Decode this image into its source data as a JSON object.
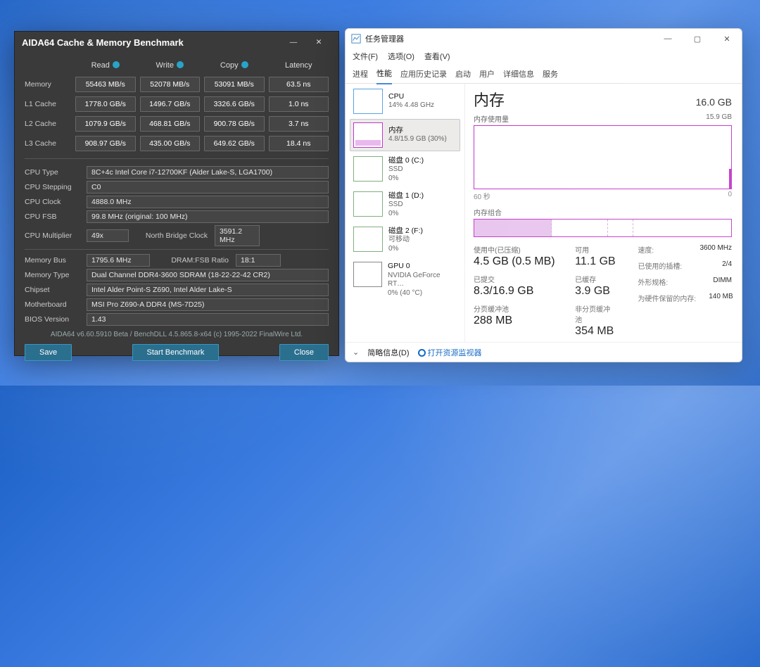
{
  "aida": {
    "title": "AIDA64 Cache & Memory Benchmark",
    "headers": {
      "read": "Read",
      "write": "Write",
      "copy": "Copy",
      "latency": "Latency"
    },
    "rows": [
      {
        "label": "Memory",
        "read": "55463 MB/s",
        "write": "52078 MB/s",
        "copy": "53091 MB/s",
        "lat": "63.5 ns"
      },
      {
        "label": "L1 Cache",
        "read": "1778.0 GB/s",
        "write": "1496.7 GB/s",
        "copy": "3326.6 GB/s",
        "lat": "1.0 ns"
      },
      {
        "label": "L2 Cache",
        "read": "1079.9 GB/s",
        "write": "468.81 GB/s",
        "copy": "900.78 GB/s",
        "lat": "3.7 ns"
      },
      {
        "label": "L3 Cache",
        "read": "908.97 GB/s",
        "write": "435.00 GB/s",
        "copy": "649.62 GB/s",
        "lat": "18.4 ns"
      }
    ],
    "info": {
      "cpu_type_label": "CPU Type",
      "cpu_type": "8C+4c Intel Core i7-12700KF  (Alder Lake-S, LGA1700)",
      "cpu_step_label": "CPU Stepping",
      "cpu_step": "C0",
      "cpu_clock_label": "CPU Clock",
      "cpu_clock": "4888.0 MHz",
      "cpu_fsb_label": "CPU FSB",
      "cpu_fsb": "99.8 MHz  (original: 100 MHz)",
      "cpu_mult_label": "CPU Multiplier",
      "cpu_mult": "49x",
      "nb_label": "North Bridge Clock",
      "nb": "3591.2 MHz",
      "membus_label": "Memory Bus",
      "membus": "1795.6 MHz",
      "dramfsb_label": "DRAM:FSB Ratio",
      "dramfsb": "18:1",
      "memtype_label": "Memory Type",
      "memtype": "Dual Channel DDR4-3600 SDRAM  (18-22-22-42 CR2)",
      "chipset_label": "Chipset",
      "chipset": "Intel Alder Point-S Z690, Intel Alder Lake-S",
      "mb_label": "Motherboard",
      "mb": "MSI Pro Z690-A DDR4 (MS-7D25)",
      "bios_label": "BIOS Version",
      "bios": "1.43"
    },
    "footer": "AIDA64 v6.60.5910 Beta / BenchDLL 4.5.865.8-x64  (c) 1995-2022 FinalWire Ltd.",
    "buttons": {
      "save": "Save",
      "start": "Start Benchmark",
      "close": "Close"
    }
  },
  "tm": {
    "title": "任务管理器",
    "menu": [
      "文件(F)",
      "选项(O)",
      "查看(V)"
    ],
    "tabs": [
      "进程",
      "性能",
      "应用历史记录",
      "启动",
      "用户",
      "详细信息",
      "服务"
    ],
    "active_tab": 1,
    "side": [
      {
        "name": "CPU",
        "sub": "14% 4.48 GHz",
        "kind": "cpu"
      },
      {
        "name": "内存",
        "sub": "4.8/15.9 GB (30%)",
        "kind": "mem",
        "active": true
      },
      {
        "name": "磁盘 0 (C:)",
        "sub": "SSD",
        "sub2": "0%",
        "kind": "disk"
      },
      {
        "name": "磁盘 1 (D:)",
        "sub": "SSD",
        "sub2": "0%",
        "kind": "disk"
      },
      {
        "name": "磁盘 2 (F:)",
        "sub": "可移动",
        "sub2": "0%",
        "kind": "disk"
      },
      {
        "name": "GPU 0",
        "sub": "NVIDIA GeForce RT…",
        "sub2": "0%  (40 °C)",
        "kind": "gpu"
      }
    ],
    "main": {
      "heading": "内存",
      "total": "16.0 GB",
      "usage_label": "内存使用量",
      "usage_right": "15.9 GB",
      "axis_left": "60 秒",
      "axis_right": "0",
      "comp_label": "内存组合",
      "pairs": [
        {
          "k": "使用中(已压缩)",
          "v": "4.5 GB (0.5 MB)"
        },
        {
          "k": "可用",
          "v": "11.1 GB"
        },
        {
          "k": "已提交",
          "v": "8.3/16.9 GB"
        },
        {
          "k": "已缓存",
          "v": "3.9 GB"
        },
        {
          "k": "分页缓冲池",
          "v": "288 MB"
        },
        {
          "k": "非分页缓冲池",
          "v": "354 MB"
        }
      ],
      "right": [
        {
          "k": "速度:",
          "v": "3600 MHz"
        },
        {
          "k": "已使用的插槽:",
          "v": "2/4"
        },
        {
          "k": "外形规格:",
          "v": "DIMM"
        },
        {
          "k": "为硬件保留的内存:",
          "v": "140 MB"
        }
      ]
    },
    "footer": {
      "brief": "简略信息(D)",
      "resmon": "打开资源监视器"
    }
  }
}
